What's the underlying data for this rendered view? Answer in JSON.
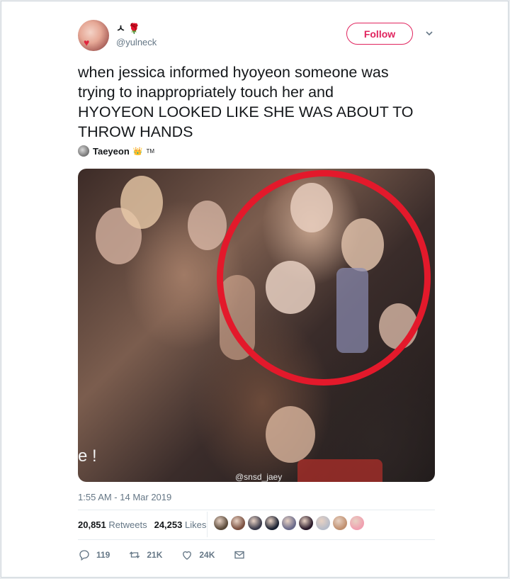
{
  "author": {
    "display_name": "ㅅ",
    "display_emoji": "🌹",
    "handle": "@yulneck"
  },
  "follow_label": "Follow",
  "tweet_text": "when jessica informed hyoyeon someone was\ntrying to inappropriately touch her and\nHYOYEON LOOKED LIKE SHE WAS ABOUT TO\nTHROW HANDS",
  "mention": {
    "name": "Taeyeon",
    "badge": "👑",
    "tm": "TM"
  },
  "media": {
    "watermark": "@snsd_jaey",
    "edge_text": "e !",
    "highlight_color": "#e3192b"
  },
  "timestamp": "1:55 AM - 14 Mar 2019",
  "stats": {
    "retweets_count": "20,851",
    "retweets_label": "Retweets",
    "likes_count": "24,253",
    "likes_label": "Likes"
  },
  "likers": [
    {
      "color": "#5a4a3a"
    },
    {
      "color": "#7a5040"
    },
    {
      "color": "#3a3a4a"
    },
    {
      "color": "#1a2030"
    },
    {
      "color": "#6a6a8a"
    },
    {
      "color": "#2a1a2a"
    },
    {
      "color": "#b7bcc8"
    },
    {
      "color": "#c09070"
    },
    {
      "color": "#f0a0b0"
    }
  ],
  "actions": {
    "replies": "119",
    "retweets": "21K",
    "likes": "24K"
  },
  "colors": {
    "accent": "#e0245e",
    "text_secondary": "#657786"
  }
}
